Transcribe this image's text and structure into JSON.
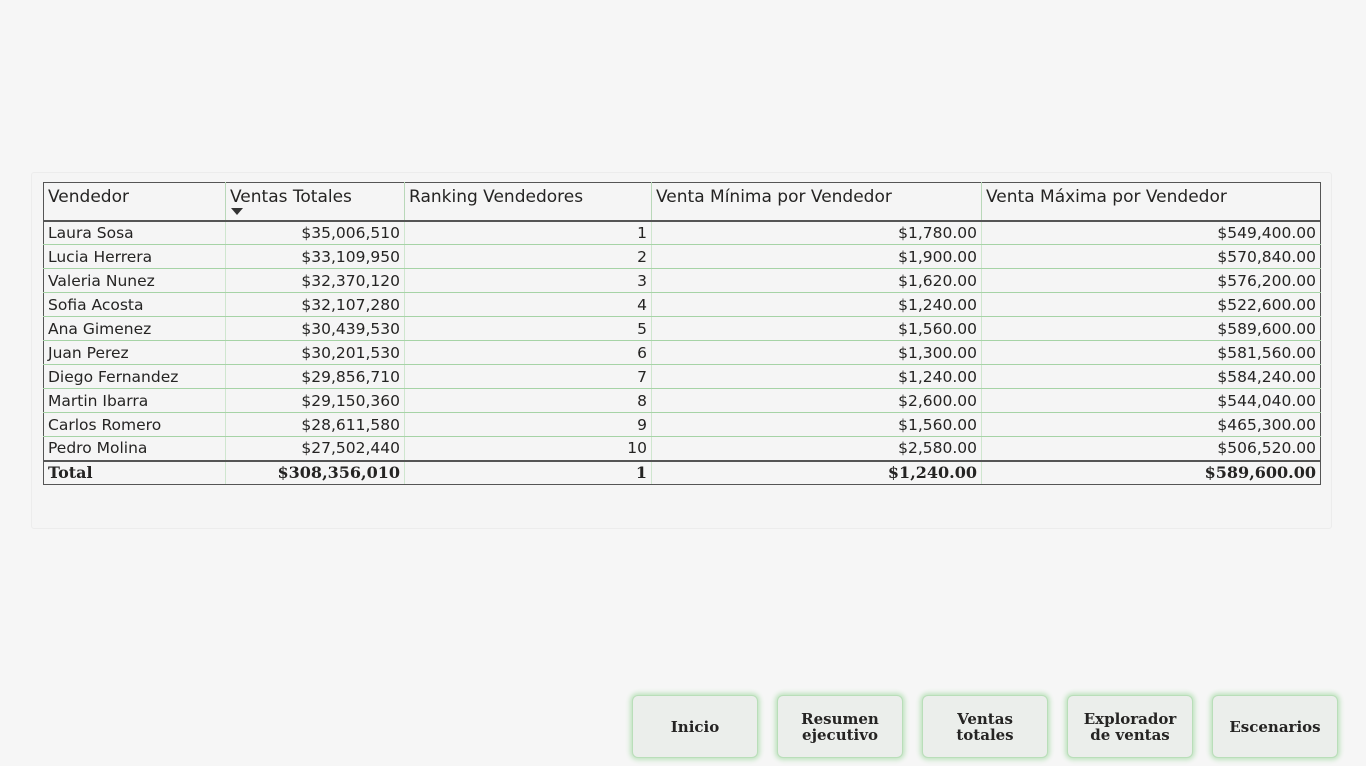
{
  "table": {
    "headers": [
      "Vendedor",
      "Ventas Totales",
      "Ranking Vendedores",
      "Venta Mínima por Vendedor",
      "Venta Máxima por Vendedor"
    ],
    "sorted_column": "Ventas Totales",
    "sort_direction": "descending",
    "rows": [
      [
        "Laura Sosa",
        "$35,006,510",
        "1",
        "$1,780.00",
        "$549,400.00"
      ],
      [
        "Lucia Herrera",
        "$33,109,950",
        "2",
        "$1,900.00",
        "$570,840.00"
      ],
      [
        "Valeria Nunez",
        "$32,370,120",
        "3",
        "$1,620.00",
        "$576,200.00"
      ],
      [
        "Sofia Acosta",
        "$32,107,280",
        "4",
        "$1,240.00",
        "$522,600.00"
      ],
      [
        "Ana Gimenez",
        "$30,439,530",
        "5",
        "$1,560.00",
        "$589,600.00"
      ],
      [
        "Juan Perez",
        "$30,201,530",
        "6",
        "$1,300.00",
        "$581,560.00"
      ],
      [
        "Diego Fernandez",
        "$29,856,710",
        "7",
        "$1,240.00",
        "$584,240.00"
      ],
      [
        "Martin Ibarra",
        "$29,150,360",
        "8",
        "$2,600.00",
        "$544,040.00"
      ],
      [
        "Carlos Romero",
        "$28,611,580",
        "9",
        "$1,560.00",
        "$465,300.00"
      ],
      [
        "Pedro Molina",
        "$27,502,440",
        "10",
        "$2,580.00",
        "$506,520.00"
      ]
    ],
    "total": [
      "Total",
      "$308,356,010",
      "1",
      "$1,240.00",
      "$589,600.00"
    ]
  },
  "nav": {
    "inicio": "Inicio",
    "resumen": "Resumen\nejecutivo",
    "ventas": "Ventas\ntotales",
    "explorador": "Explorador\nde ventas",
    "escenarios": "Escenarios"
  },
  "colors": {
    "background": "#f6f6f6",
    "gridline": "#a6d3a6",
    "button_glow": "#bfe3bf"
  }
}
